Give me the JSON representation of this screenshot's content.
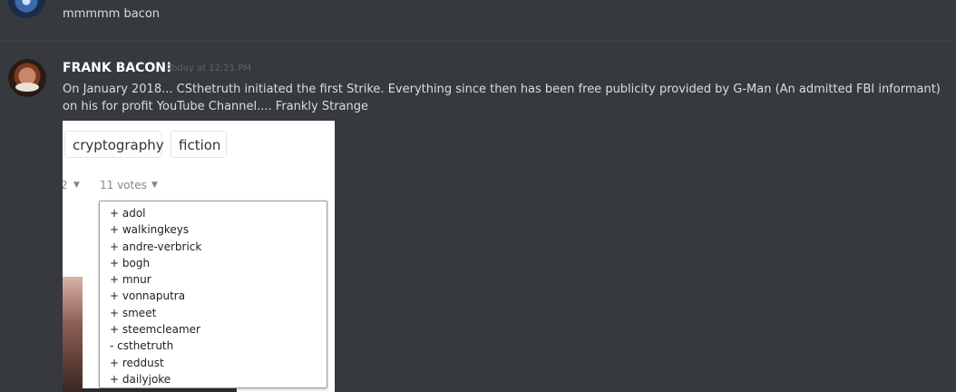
{
  "previous_message": {
    "text": "mmmmm bacon"
  },
  "message": {
    "username": "FRANK BACON!",
    "timestamp": "Today at 12:21 PM",
    "text": "On January 2018... CSthetruth initiated the first Strike.  Everything since then has been free publicity provided by G-Man (An admitted FBI informant) on his for profit YouTube Channel.... Frankly Strange"
  },
  "embed": {
    "tags": [
      "cryptography",
      "fiction"
    ],
    "prev_vote_count": "2",
    "votes_label": "11 votes",
    "voters": [
      "+ adol",
      "+ walkingkeys",
      "+ andre-verbrick",
      "+ bogh",
      "+ mnur",
      "+ vonnaputra",
      "+ smeet",
      "+ steemcleamer",
      "- csthetruth",
      "+ reddust",
      "+ dailyjoke"
    ]
  }
}
